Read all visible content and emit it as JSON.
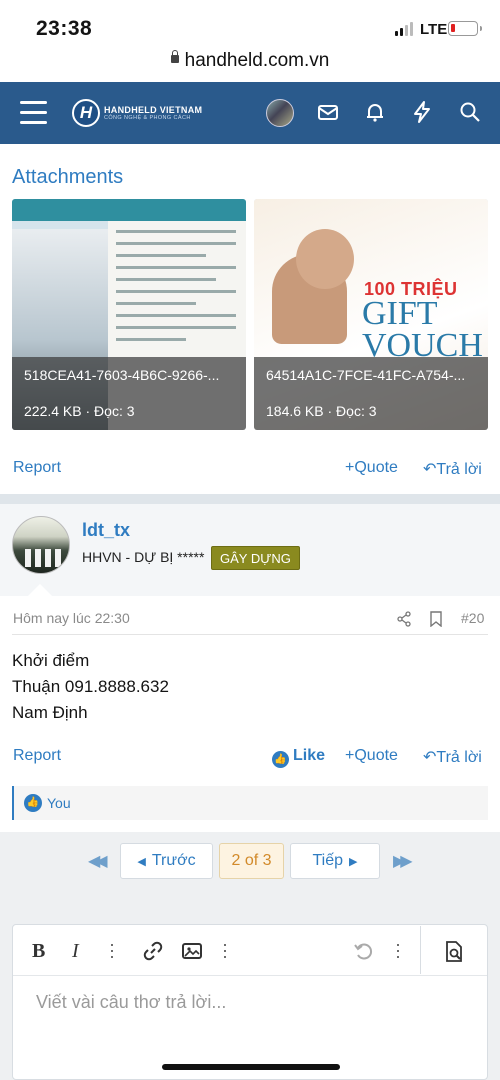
{
  "status_bar": {
    "time": "23:38",
    "network": "LTE"
  },
  "browser": {
    "url": "handheld.com.vn"
  },
  "site_header": {
    "logo_title": "HANDHELD VIETNAM",
    "logo_tagline": "CÔNG NGHỆ & PHONG CÁCH",
    "logo_letter": "H"
  },
  "attachments": {
    "heading": "Attachments",
    "items": [
      {
        "name": "518CEA41-7603-4B6C-9266-...",
        "meta": "222.4 KB · Đọc: 3"
      },
      {
        "name": "64514A1C-7FCE-41FC-A754-...",
        "meta": "184.6 KB · Đọc: 3"
      }
    ],
    "image_text": {
      "amount": "100 TRIỆU",
      "line1": "GIFT",
      "line2": "VOUCH"
    }
  },
  "post19_actions": {
    "report": "Report",
    "quote": "Quote",
    "reply": "Trả lời"
  },
  "post20": {
    "username": "ldt_tx",
    "user_title": "HHVN - DỰ BỊ *****",
    "badge": "GÂY DỰNG",
    "timestamp": "Hôm nay lúc 22:30",
    "number": "#20",
    "body": [
      "Khởi điểm",
      "Thuận 091.8888.632",
      "Nam Định"
    ],
    "actions": {
      "report": "Report",
      "like": "Like",
      "quote": "Quote",
      "reply": "Trả lời"
    },
    "likes": "You"
  },
  "pagination": {
    "prev": "Trước",
    "current": "2 of 3",
    "next": "Tiếp"
  },
  "editor": {
    "placeholder": "Viết vài câu thơ trả lời..."
  },
  "colors": {
    "header": "#2a5a8c",
    "link": "#2f7cc1",
    "badge": "#8a8a1f"
  }
}
